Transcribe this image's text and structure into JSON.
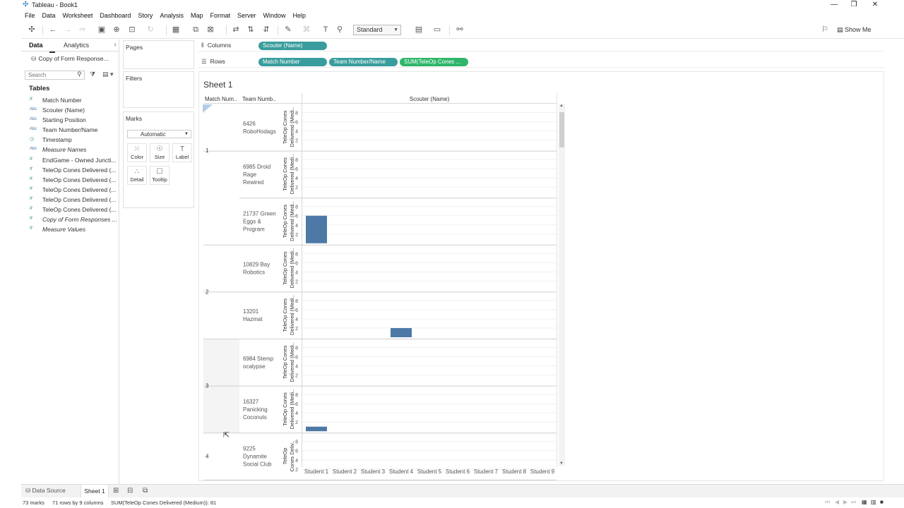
{
  "window": {
    "title": "Tableau - Book1",
    "controls": {
      "minimize": "—",
      "restore": "❐",
      "close": "✕"
    }
  },
  "menu": [
    "File",
    "Data",
    "Worksheet",
    "Dashboard",
    "Story",
    "Analysis",
    "Map",
    "Format",
    "Server",
    "Window",
    "Help"
  ],
  "toolbar": {
    "fit": "Standard",
    "show_me": "Show Me"
  },
  "data_pane": {
    "tabs": [
      "Data",
      "Analytics"
    ],
    "datasource": "Copy of Form Response...",
    "search_placeholder": "Search",
    "tables_heading": "Tables",
    "fields": [
      {
        "type": "#",
        "name": "Match Number",
        "italic": false
      },
      {
        "type": "Abc",
        "name": "Scouter (Name)",
        "italic": false
      },
      {
        "type": "Abc",
        "name": "Starting Position",
        "italic": false
      },
      {
        "type": "Abc",
        "name": "Team Number/Name",
        "italic": false
      },
      {
        "type": "◷",
        "name": "Timestamp",
        "italic": false
      },
      {
        "type": "Abc",
        "name": "Measure Names",
        "italic": true
      },
      {
        "type": "#",
        "name": "EndGame - Owned Juncti...",
        "italic": false
      },
      {
        "type": "#",
        "name": "TeleOp Cones Delivered (...",
        "italic": false
      },
      {
        "type": "#",
        "name": "TeleOp Cones Delivered (...",
        "italic": false
      },
      {
        "type": "#",
        "name": "TeleOp Cones Delivered (...",
        "italic": false
      },
      {
        "type": "#",
        "name": "TeleOp Cones Delivered (...",
        "italic": false
      },
      {
        "type": "#",
        "name": "TeleOp Cones Delivered (...",
        "italic": false
      },
      {
        "type": "#",
        "name": "Copy of Form Responses ...",
        "italic": true
      },
      {
        "type": "#",
        "name": "Measure Values",
        "italic": true
      }
    ]
  },
  "cards": {
    "pages": "Pages",
    "filters": "Filters",
    "marks": "Marks",
    "mark_type": "Automatic",
    "mark_buttons": [
      {
        "icon": "⁙",
        "label": "Color"
      },
      {
        "icon": "☉",
        "label": "Size"
      },
      {
        "icon": "T",
        "label": "Label"
      },
      {
        "icon": "∴",
        "label": "Detail"
      },
      {
        "icon": "☐",
        "label": "Tooltip"
      }
    ]
  },
  "shelves": {
    "columns_label": "Columns",
    "rows_label": "Rows",
    "columns_pills": [
      "Scouter (Name)"
    ],
    "rows_pills": [
      "Match Number",
      "Team Number/Name",
      "SUM(TeleOp Cones ..."
    ]
  },
  "sheet": {
    "title": "Sheet 1",
    "header_match": "Match Num..",
    "header_team": "Team Numb..",
    "header_columns": "Scouter (Name)",
    "axis_title_full": [
      "TeleOp Cones",
      "Delivered (Medi.."
    ],
    "axis_title_last": [
      "TeleOp",
      "Cones Deliv.."
    ]
  },
  "chart_data": {
    "type": "bar",
    "title": "Sheet 1",
    "x_field": "Scouter (Name)",
    "categories": [
      "Student 1",
      "Student 2",
      "Student 3",
      "Student 4",
      "Student 5",
      "Student 6",
      "Student 7",
      "Student 8",
      "Student 9"
    ],
    "y_ticks": [
      2,
      4,
      6,
      8
    ],
    "ylim": [
      0,
      9
    ],
    "grid": true,
    "color": "#4e79a7",
    "rows": [
      {
        "match": "1",
        "team": [
          "6426",
          "RoboHodags"
        ],
        "bars": []
      },
      {
        "match": "",
        "team": [
          "6985 Droid",
          "Rage",
          "Rewired"
        ],
        "bars": []
      },
      {
        "match": "",
        "team": [
          "21737 Green",
          "Eggs &",
          "Program"
        ],
        "bars": [
          {
            "category": "Student 1",
            "value": 6
          }
        ]
      },
      {
        "match": "2",
        "team": [
          "10829 Bay",
          "Robotics"
        ],
        "bars": []
      },
      {
        "match": "",
        "team": [
          "13201",
          "Hazmat"
        ],
        "bars": [
          {
            "category": "Student 4",
            "value": 2
          }
        ]
      },
      {
        "match": "3",
        "team": [
          "6984 Stemp",
          "ocalypse"
        ],
        "bars": []
      },
      {
        "match": "",
        "team": [
          "16327",
          "Panicking",
          "Coconuts"
        ],
        "bars": [
          {
            "category": "Student 1",
            "value": 1
          }
        ]
      },
      {
        "match": "4",
        "team": [
          "9225",
          "Dynamite",
          "Social Club"
        ],
        "bars": []
      }
    ]
  },
  "bottom": {
    "datasource_tab": "Data Source",
    "sheet_tab": "Sheet 1"
  },
  "status": {
    "marks": "73 marks",
    "dims": "71 rows by 9 columns",
    "sum": "SUM(TeleOp Cones Delivered (Medium)): 81"
  }
}
